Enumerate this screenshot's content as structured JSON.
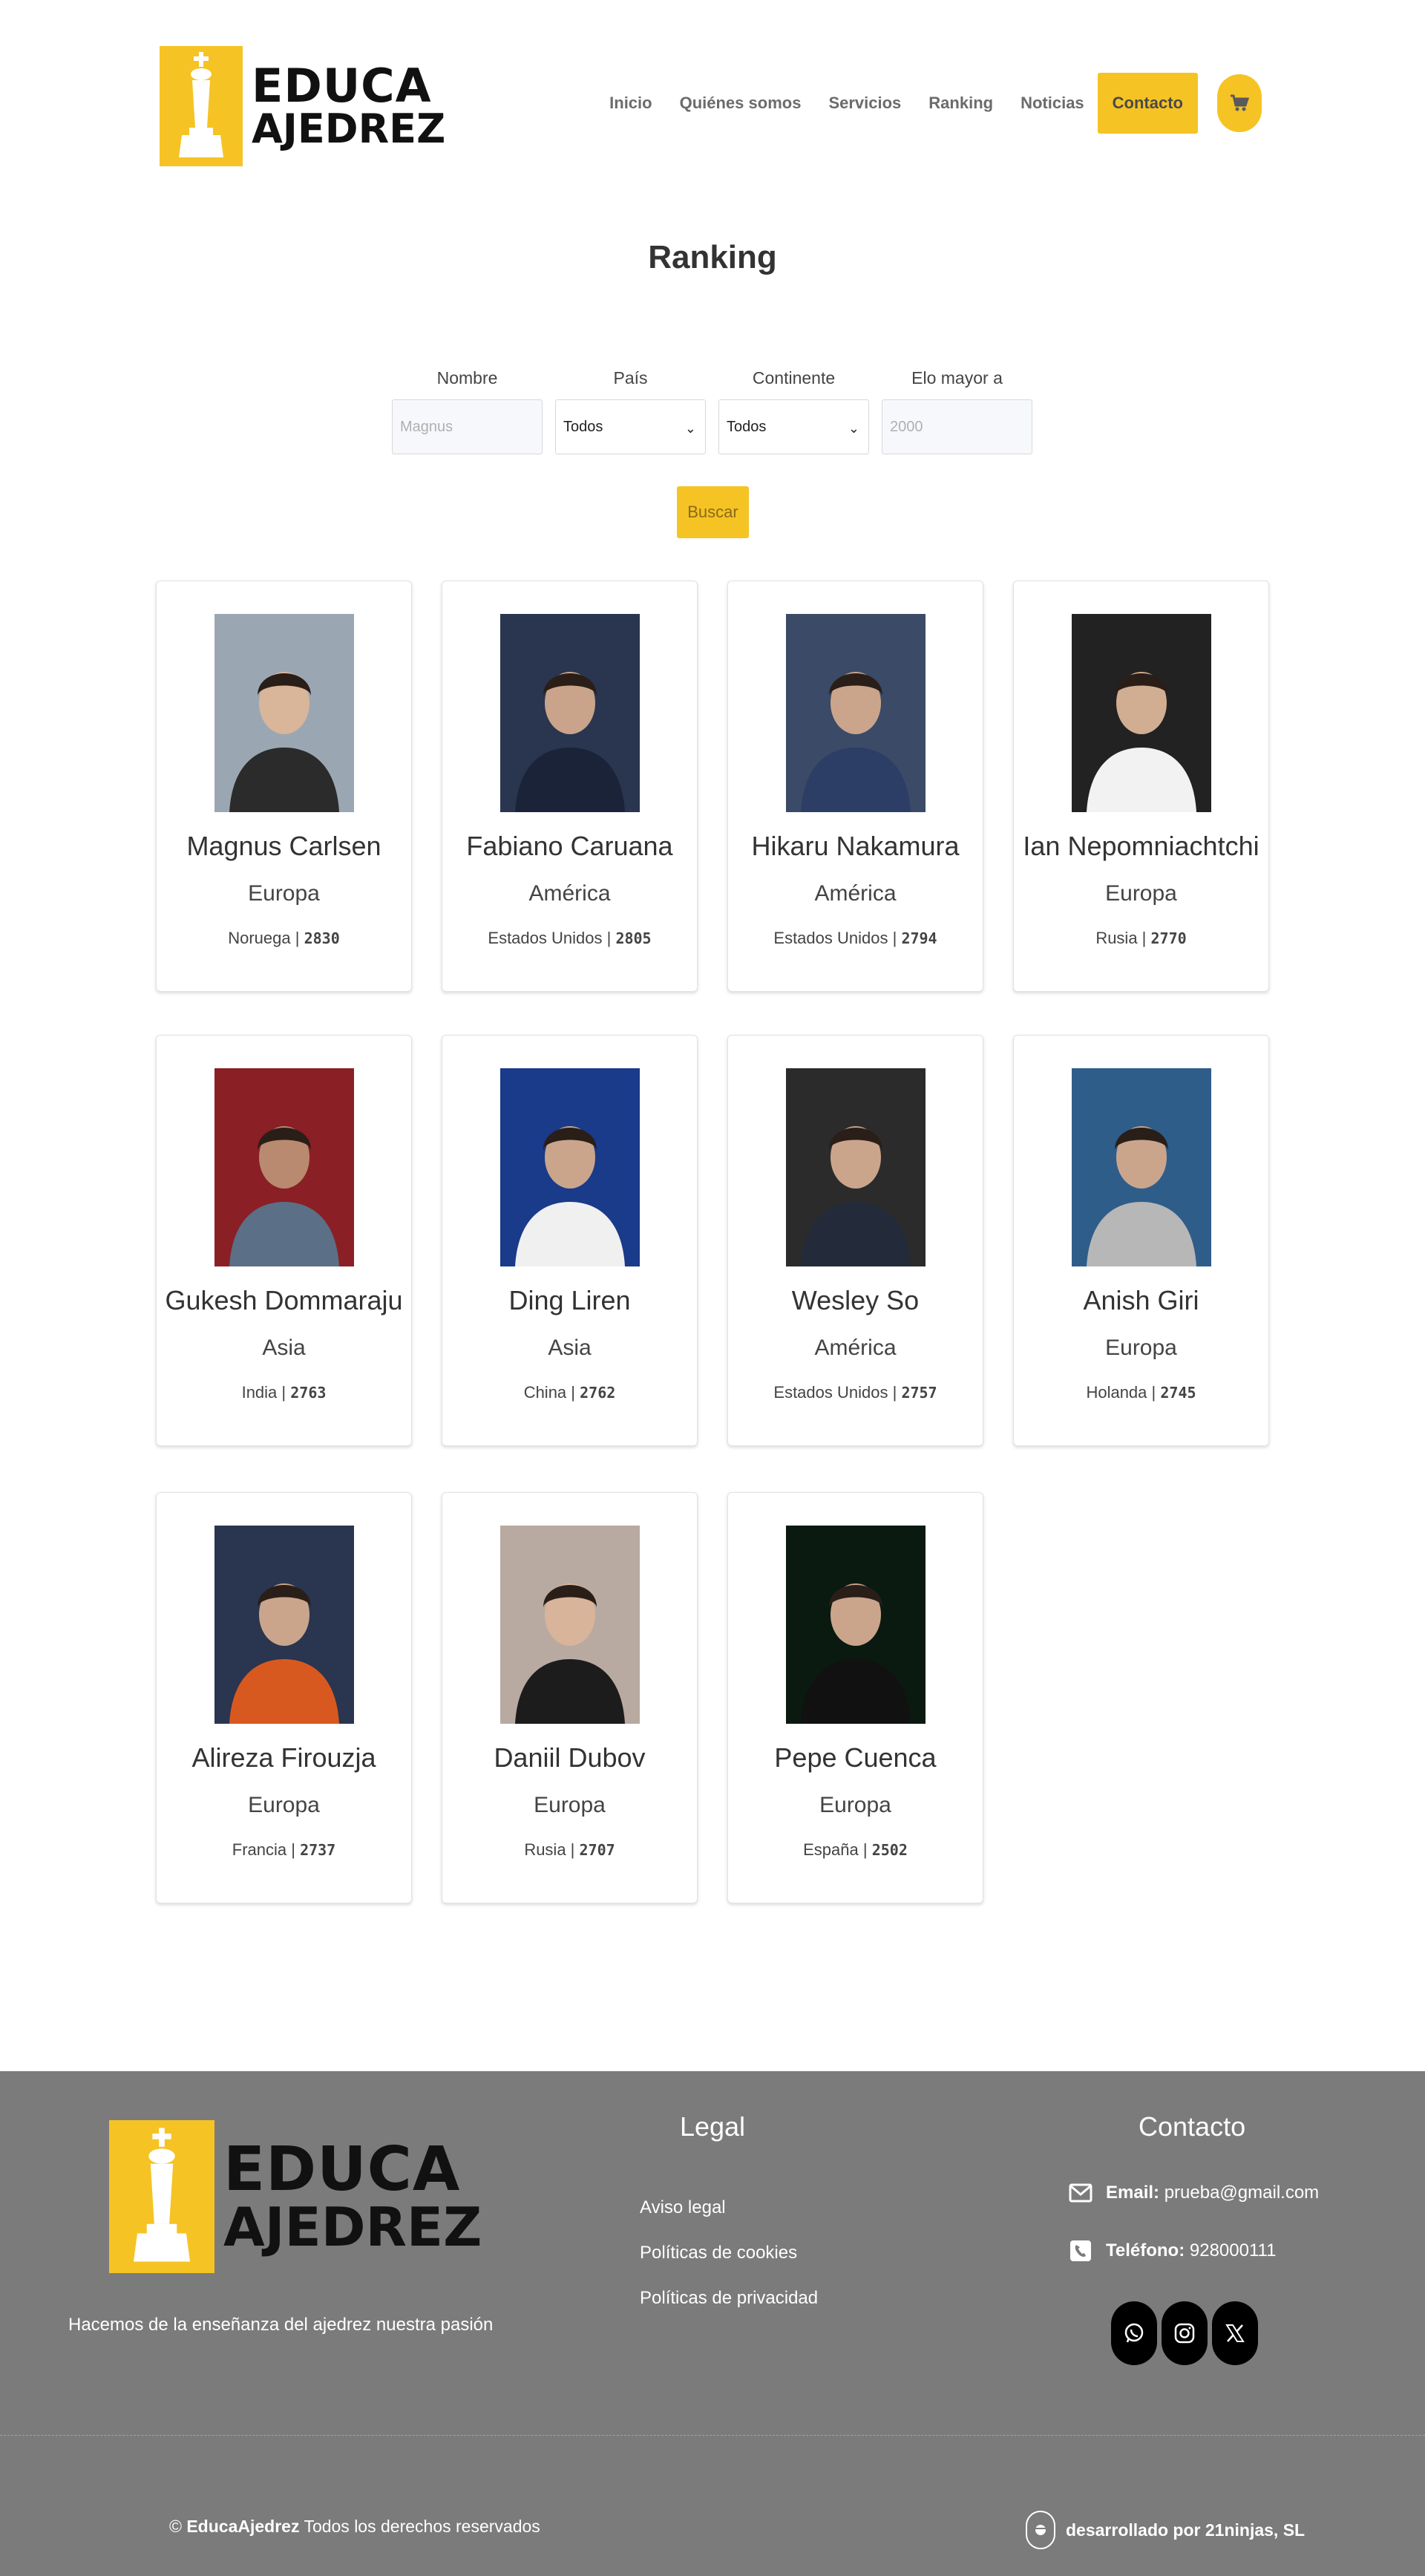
{
  "brand": {
    "line1": "EDUCA",
    "line2": "AJEDREZ",
    "color": "#f6c324"
  },
  "nav": {
    "items": [
      "Inicio",
      "Quiénes somos",
      "Servicios",
      "Ranking",
      "Noticias"
    ],
    "contact": "Contacto",
    "cart_icon": "cart-icon"
  },
  "page": {
    "title": "Ranking"
  },
  "filters": {
    "name_label": "Nombre",
    "name_placeholder": "Magnus",
    "country_label": "País",
    "country_value": "Todos",
    "continent_label": "Continente",
    "continent_value": "Todos",
    "elo_label": "Elo mayor a",
    "elo_placeholder": "2000",
    "search_button": "Buscar"
  },
  "players": [
    {
      "name": "Magnus Carlsen",
      "continent": "Europa",
      "country": "Noruega",
      "elo": "2830"
    },
    {
      "name": "Fabiano Caruana",
      "continent": "América",
      "country": "Estados Unidos",
      "elo": "2805"
    },
    {
      "name": "Hikaru Nakamura",
      "continent": "América",
      "country": "Estados Unidos",
      "elo": "2794"
    },
    {
      "name": "Ian Nepomniachtchi",
      "continent": "Europa",
      "country": "Rusia",
      "elo": "2770"
    },
    {
      "name": "Gukesh Dommaraju",
      "continent": "Asia",
      "country": "India",
      "elo": "2763"
    },
    {
      "name": "Ding Liren",
      "continent": "Asia",
      "country": "China",
      "elo": "2762"
    },
    {
      "name": "Wesley So",
      "continent": "América",
      "country": "Estados Unidos",
      "elo": "2757"
    },
    {
      "name": "Anish Giri",
      "continent": "Europa",
      "country": "Holanda",
      "elo": "2745"
    },
    {
      "name": "Alireza Firouzja",
      "continent": "Europa",
      "country": "Francia",
      "elo": "2737"
    },
    {
      "name": "Daniil Dubov",
      "continent": "Europa",
      "country": "Rusia",
      "elo": "2707"
    },
    {
      "name": "Pepe Cuenca",
      "continent": "Europa",
      "country": "España",
      "elo": "2502"
    }
  ],
  "footer": {
    "slogan": "Hacemos de la enseñanza del ajedrez nuestra pasión",
    "legal_title": "Legal",
    "legal_links": [
      "Aviso legal",
      "Políticas de cookies",
      "Políticas de privacidad"
    ],
    "contact_title": "Contacto",
    "email_label": "Email:",
    "email_value": "prueba@gmail.com",
    "phone_label": "Teléfono:",
    "phone_value": "928000111",
    "social": [
      "whatsapp-icon",
      "instagram-icon",
      "x-icon"
    ],
    "copyright_prefix": "©",
    "copyright_brand": "EducaAjedrez",
    "copyright_text": "Todos los derechos reservados",
    "developer": "desarrollado por 21ninjas, SL"
  }
}
